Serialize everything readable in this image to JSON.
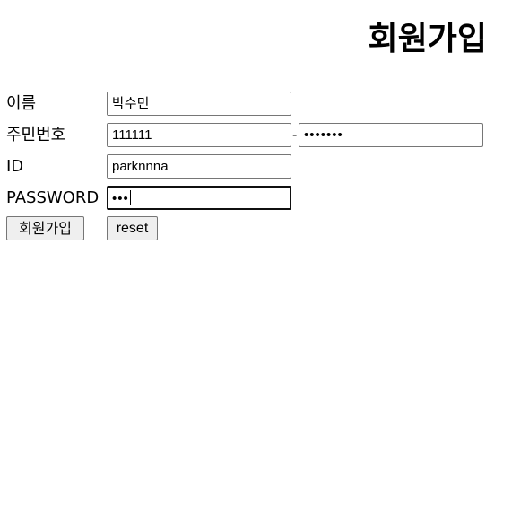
{
  "form": {
    "title": "회원가입",
    "name_label": "이름",
    "name_value": "박수민",
    "ssn_label": "주민번호",
    "ssn_first_value": "111111",
    "ssn_separator": "-",
    "ssn_second_masked": "•••••••",
    "id_label": "ID",
    "id_value": "parknnna",
    "password_label": "PASSWORD",
    "password_masked": "•••",
    "submit_label": "회원가입",
    "reset_label": "reset"
  }
}
